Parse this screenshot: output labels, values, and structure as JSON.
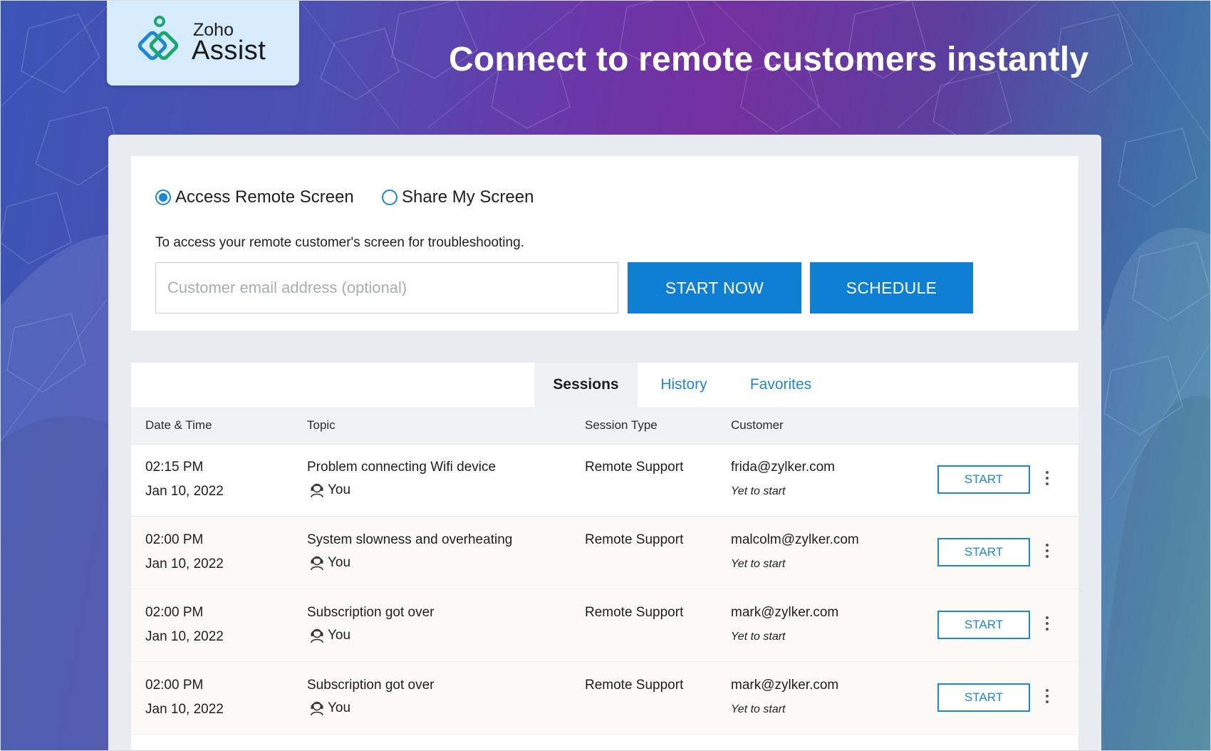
{
  "brand": {
    "small": "Zoho",
    "large": "Assist",
    "mark_icon": "zoho-assist-logo-icon",
    "mark_colors": [
      "#1ba672",
      "#1f86d6"
    ]
  },
  "headline": "Connect to remote customers instantly",
  "connect": {
    "modes": [
      {
        "label": "Access Remote Screen",
        "selected": true
      },
      {
        "label": "Share My Screen",
        "selected": false
      }
    ],
    "description": "To access your remote customer's screen for troubleshooting.",
    "email_placeholder": "Customer email address (optional)",
    "email_value": "",
    "start_now_label": "START NOW",
    "schedule_label": "SCHEDULE"
  },
  "tabs": [
    {
      "label": "Sessions",
      "active": true
    },
    {
      "label": "History",
      "active": false
    },
    {
      "label": "Favorites",
      "active": false
    }
  ],
  "table": {
    "columns": {
      "date": "Date & Time",
      "topic": "Topic",
      "type": "Session Type",
      "customer": "Customer"
    },
    "rows": [
      {
        "time": "02:15 PM",
        "date": "Jan 10, 2022",
        "topic": "Problem connecting Wifi device",
        "owner": "You",
        "type": "Remote Support",
        "email": "frida@zylker.com",
        "status": "Yet to start",
        "action": "START"
      },
      {
        "time": "02:00 PM",
        "date": "Jan 10, 2022",
        "topic": "System slowness and overheating",
        "owner": "You",
        "type": "Remote Support",
        "email": "malcolm@zylker.com",
        "status": "Yet to start",
        "action": "START"
      },
      {
        "time": "02:00 PM",
        "date": "Jan 10, 2022",
        "topic": "Subscription got over",
        "owner": "You",
        "type": "Remote Support",
        "email": "mark@zylker.com",
        "status": "Yet to start",
        "action": "START"
      },
      {
        "time": "02:00 PM",
        "date": "Jan 10, 2022",
        "topic": "Subscription got over",
        "owner": "You",
        "type": "Remote Support",
        "email": "mark@zylker.com",
        "status": "Yet to start",
        "action": "START"
      }
    ]
  },
  "colors": {
    "accent": "#1f86d6",
    "primary_button": "#0f7fd4"
  }
}
